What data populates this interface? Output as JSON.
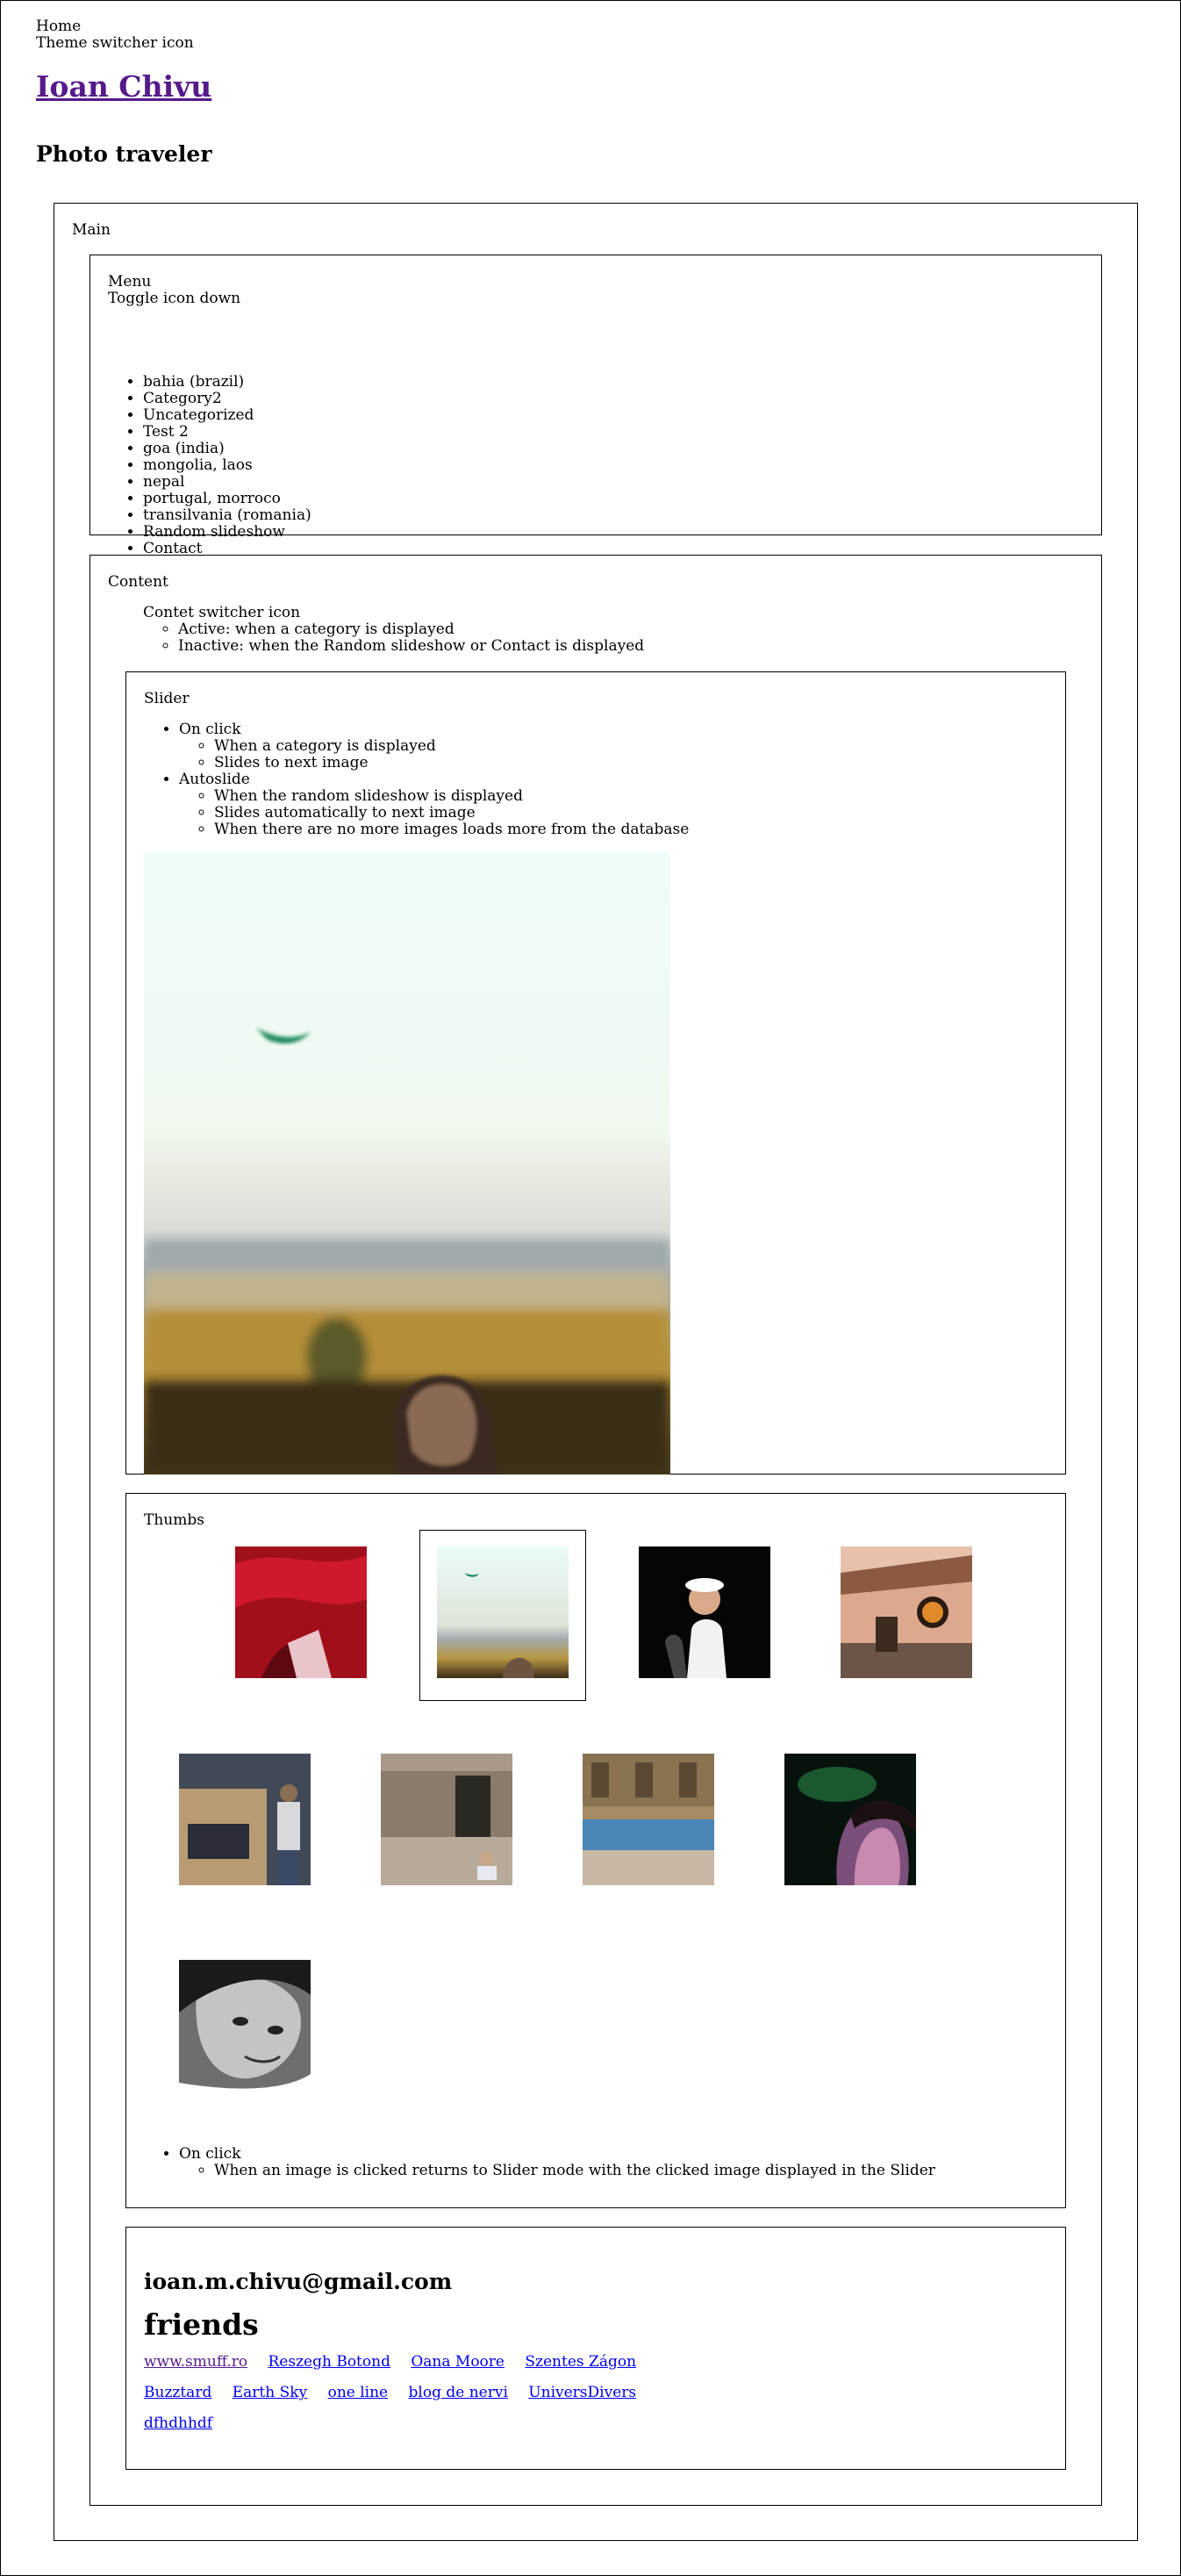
{
  "header": {
    "home_label": "Home",
    "theme_switcher_label": "Theme switcher icon",
    "site_title": "Ioan Chivu",
    "tagline": "Photo traveler"
  },
  "main": {
    "label": "Main",
    "menu": {
      "label": "Menu",
      "toggle_label": "Toggle icon down",
      "items": [
        "bahia (brazil)",
        "Category2",
        "Uncategorized",
        "Test 2",
        "goa (india)",
        "mongolia, laos",
        "nepal",
        "portugal, morroco",
        "transilvania (romania)",
        "Random slideshow",
        "Contact"
      ]
    },
    "content": {
      "label": "Content",
      "switcher_label": "Contet switcher icon",
      "switcher_states": [
        "Active: when a category is displayed",
        "Inactive: when the Random slideshow or Contact is displayed"
      ],
      "slider": {
        "label": "Slider",
        "behaviors": [
          {
            "title": "On click",
            "details": [
              "When a category is displayed",
              "Slides to next image"
            ]
          },
          {
            "title": "Autoslide",
            "details": [
              "When the random slideshow is displayed",
              "Slides automatically to next image",
              "When there are no more images loads more from the database"
            ]
          }
        ]
      },
      "thumbs": {
        "label": "Thumbs",
        "behavior_title": "On click",
        "behavior_detail": "When an image is clicked returns to Slider mode with the clicked image displayed in the Slider"
      }
    },
    "footer": {
      "email": "ioan.m.chivu@gmail.com",
      "friends_title": "friends",
      "links_row1": [
        "www.smuff.ro",
        "Reszegh Botond",
        "Oana Moore",
        "Szentes Zágon"
      ],
      "links_row2": [
        "Buzztard",
        "Earth Sky",
        "one line",
        "blog de nervi",
        "UniversDivers"
      ],
      "links_row3": [
        "dfhdhhdf"
      ]
    }
  }
}
